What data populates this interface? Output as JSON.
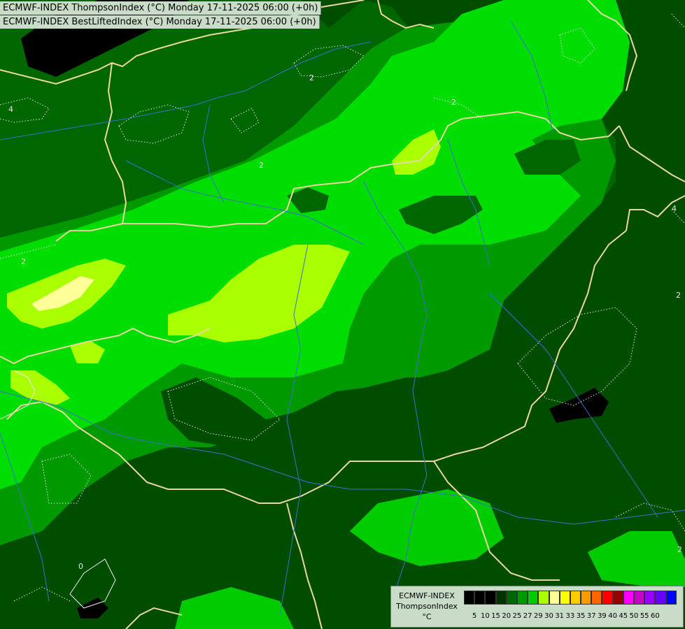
{
  "header": {
    "line1": "ECMWF-INDEX ThompsonIndex (°C) Monday 17-11-2025 06:00 (+0h)",
    "line2": "ECMWF-INDEX BestLiftedIndex (°C) Monday 17-11-2025 06:00 (+0h)"
  },
  "legend": {
    "source": "ECMWF-INDEX",
    "index": "ThompsonIndex",
    "unit": "°C",
    "ticks": [
      "5",
      "10",
      "15",
      "20",
      "25",
      "27",
      "29",
      "30",
      "31",
      "33",
      "35",
      "37",
      "39",
      "40",
      "45",
      "50",
      "55",
      "60"
    ],
    "colors": [
      "#000000",
      "#000000",
      "#000000",
      "#003300",
      "#006600",
      "#009900",
      "#00cc00",
      "#aaff00",
      "#ffff99",
      "#ffff00",
      "#ffcc00",
      "#ff9900",
      "#ff6600",
      "#ff0000",
      "#990000",
      "#ff00ff",
      "#cc00cc",
      "#9900ff",
      "#6600ff",
      "#0000ff"
    ]
  },
  "contour_labels": [
    "2",
    "2",
    "2",
    "2",
    "2",
    "2",
    "4",
    "4",
    "0"
  ],
  "colors": {
    "field_darkest": "#004d00",
    "field_dark": "#006600",
    "field_mid": "#009900",
    "field_bright": "#00dd00",
    "field_lime": "#aaff00",
    "field_yellow": "#ffff99",
    "black_area": "#000000",
    "border_line": "#e8d8a0",
    "river_line": "#3b70c8",
    "contour_line": "#e8e8e8"
  }
}
